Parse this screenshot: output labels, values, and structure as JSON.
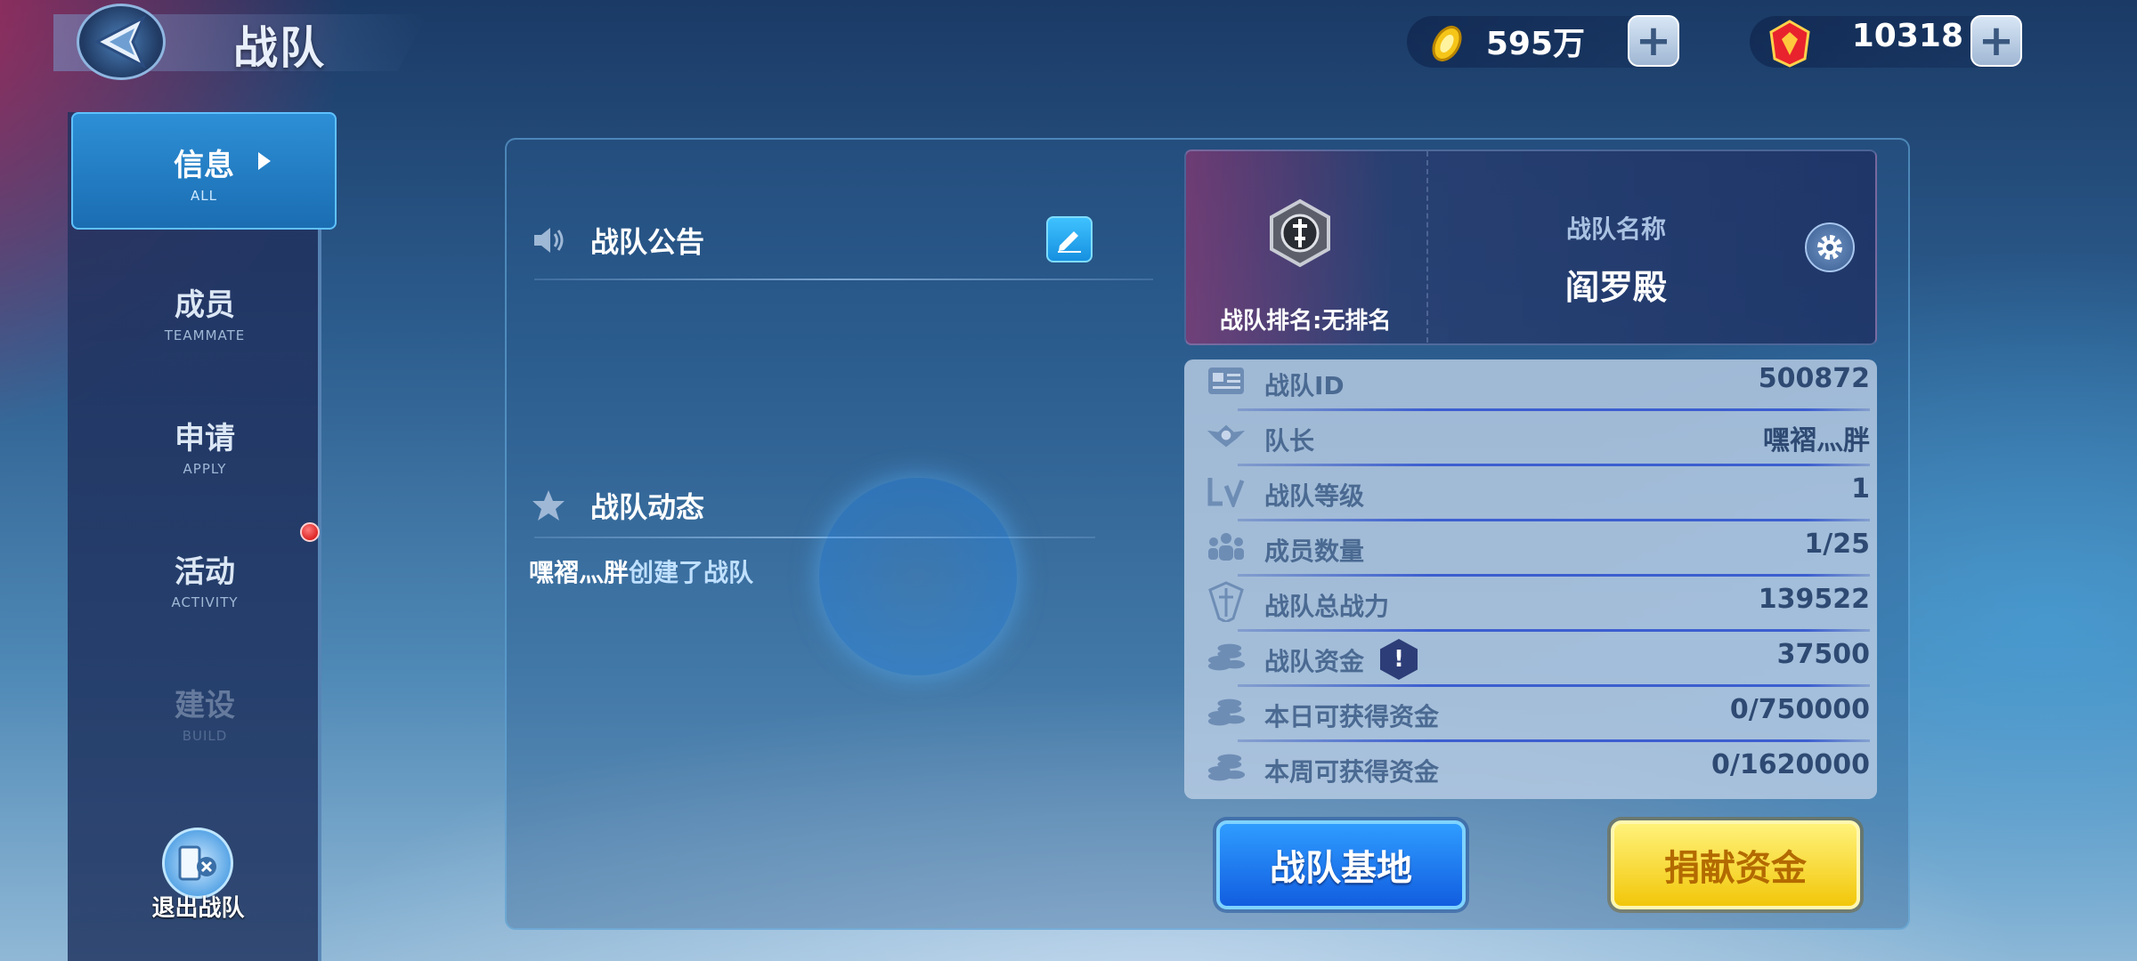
{
  "header": {
    "title": "战队",
    "gold": {
      "value": "595万",
      "icon": "gold-coin-icon"
    },
    "gems": {
      "value": "10318",
      "icon": "red-gem-icon"
    }
  },
  "sidebar": {
    "items": [
      {
        "label": "信息",
        "sub": "ALL",
        "active": true
      },
      {
        "label": "成员",
        "sub": "TEAMMATE"
      },
      {
        "label": "申请",
        "sub": "APPLY"
      },
      {
        "label": "活动",
        "sub": "ACTIVITY",
        "badge": true
      },
      {
        "label": "建设",
        "sub": "BUILD",
        "disabled": true
      }
    ],
    "quit_label": "退出战队"
  },
  "notice": {
    "title": "战队公告"
  },
  "dynamics": {
    "title": "战队动态",
    "entries": [
      {
        "name": "嘿褶灬胖",
        "action": "创建了战队"
      }
    ]
  },
  "team": {
    "rank_label": "战队排名:",
    "rank_value": "无排名",
    "name_label": "战队名称",
    "name": "阎罗殿"
  },
  "stats": [
    {
      "label": "战队ID",
      "value": "500872",
      "icon": "id-card-icon"
    },
    {
      "label": "队长",
      "value": "嘿褶灬胖",
      "icon": "captain-badge-icon"
    },
    {
      "label": "战队等级",
      "value": "1",
      "icon": "level-icon"
    },
    {
      "label": "成员数量",
      "value": "1/25",
      "icon": "members-icon"
    },
    {
      "label": "战队总战力",
      "value": "139522",
      "icon": "power-icon"
    },
    {
      "label": "战队资金",
      "value": "37500",
      "icon": "coins-icon"
    },
    {
      "label": "本日可获得资金",
      "value": "0/750000",
      "icon": "coins-icon"
    },
    {
      "label": "本周可获得资金",
      "value": "0/1620000",
      "icon": "coins-icon"
    }
  ],
  "buttons": {
    "base": "战队基地",
    "donate": "捐献资金"
  },
  "colors": {
    "accent": "#2f9cff",
    "donate": "#f2c70a",
    "badge_red": "#d00000"
  }
}
